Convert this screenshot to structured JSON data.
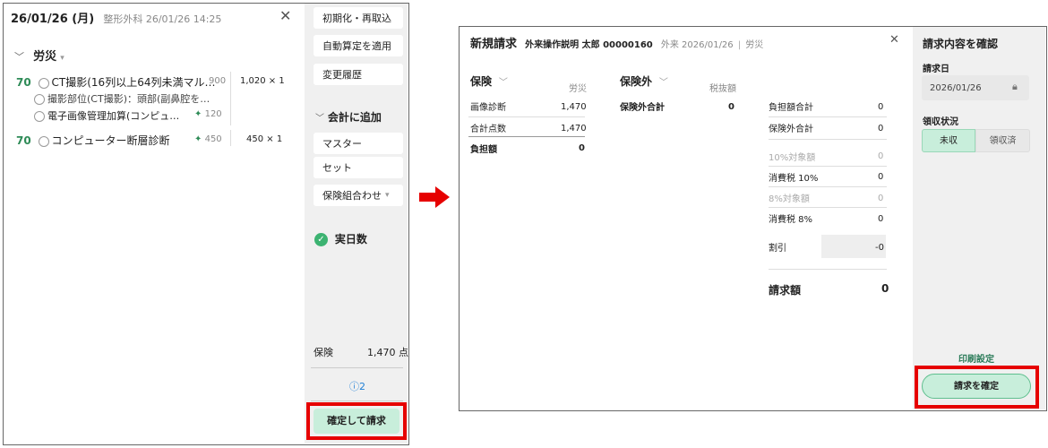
{
  "left": {
    "date": "26/01/26 (月)",
    "dept_time": "整形外科 26/01/26 14:25",
    "section": "労災",
    "items": [
      {
        "points": "70",
        "name": "CT撮影(16列以上64列未満マル…",
        "pts": "900",
        "calc": "1,020 × 1"
      },
      {
        "name": "撮影部位(CT撮影)：頭部(副鼻腔を…"
      },
      {
        "name": "電子画像管理加算(コンピュ…",
        "pts": "120"
      },
      {
        "points": "70",
        "name": "コンピューター断層診断",
        "pts": "450",
        "calc": "450 × 1"
      }
    ],
    "side_buttons": [
      "初期化・再取込",
      "自動算定を適用",
      "変更履歴"
    ],
    "add_section": "会計に追加",
    "add_items": [
      "マスター",
      "セット",
      "保険組合わせ"
    ],
    "actual_days": "実日数",
    "insurance_label": "保険",
    "insurance_value": "1,470 点",
    "info_count": "2",
    "confirm_button": "確定して請求"
  },
  "right": {
    "title": "新規請求",
    "patient": "外来操作説明 太郎 00000160",
    "visit": "外来 2026/01/26",
    "type": "労災",
    "insurance": {
      "label": "保険",
      "col": "労災",
      "rows": [
        {
          "name": "画像診断",
          "value": "1,470"
        },
        {
          "name": "合計点数",
          "value": "1,470"
        }
      ],
      "burden_label": "負担額",
      "burden_value": "0"
    },
    "non_insurance": {
      "label": "保険外",
      "col": "税抜額",
      "total_label": "保険外合計",
      "total_value": "0"
    },
    "summary": [
      {
        "name": "負担額合計",
        "value": "0"
      },
      {
        "name": "保険外合計",
        "value": "0"
      },
      {
        "name": "10%対象額",
        "value": "0"
      },
      {
        "name": "消費税 10%",
        "value": "0"
      },
      {
        "name": "8%対象額",
        "value": "0"
      },
      {
        "name": "消費税 8%",
        "value": "0"
      },
      {
        "name": "割引",
        "value": "-0"
      }
    ],
    "billing_label": "請求額",
    "billing_value": "0"
  },
  "confirm": {
    "title": "請求内容を確認",
    "date_label": "請求日",
    "date_value": "2026/01/26",
    "status_label": "領収状況",
    "unpaid": "未収",
    "paid": "領収済",
    "print": "印刷設定",
    "confirm_button": "請求を確定"
  },
  "colors": {
    "accent": "#2e8b57",
    "button_bg": "#c8eedb",
    "highlight": "#e60000"
  }
}
